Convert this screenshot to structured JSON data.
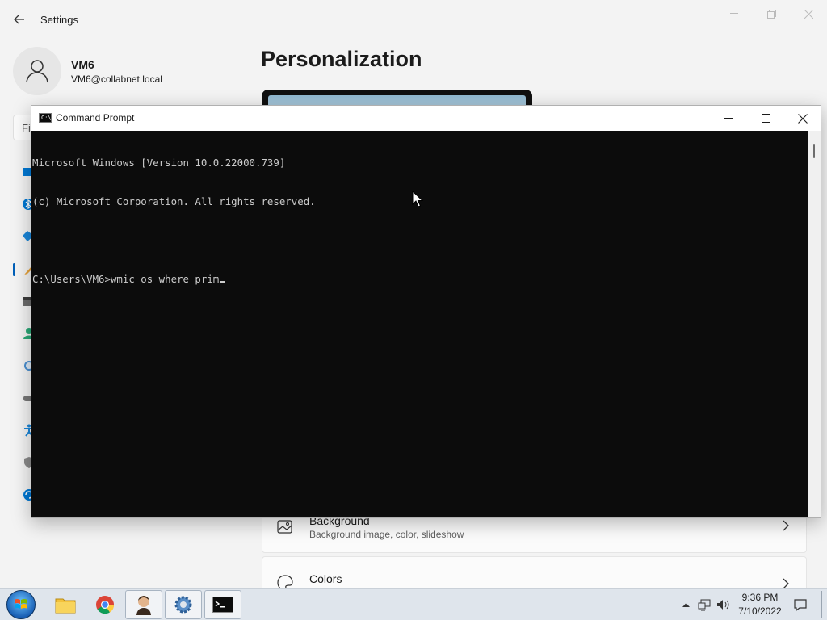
{
  "settings": {
    "app_title": "Settings",
    "user_name": "VM6",
    "user_email": "VM6@collabnet.local",
    "page_title": "Personalization",
    "search_placeholder": "Fi",
    "cards": [
      {
        "title": "Background",
        "subtitle": "Background image, color, slideshow",
        "icon": "image-icon"
      },
      {
        "title": "Colors",
        "subtitle": "",
        "icon": "palette-icon"
      }
    ],
    "nav_icons": [
      "system-icon",
      "bluetooth-icon",
      "network-icon",
      "personalization-icon",
      "apps-icon",
      "accounts-icon",
      "time-language-icon",
      "gaming-icon",
      "accessibility-icon",
      "privacy-icon",
      "update-icon"
    ]
  },
  "cmd": {
    "title": "Command Prompt",
    "lines": [
      "Microsoft Windows [Version 10.0.22000.739]",
      "(c) Microsoft Corporation. All rights reserved.",
      "",
      "C:\\Users\\VM6>wmic os where prim"
    ]
  },
  "taskbar": {
    "apps": [
      "file-explorer-icon",
      "chrome-icon",
      "user-app-icon",
      "settings-icon",
      "command-prompt-icon"
    ],
    "time": "9:36 PM",
    "date": "7/10/2022"
  },
  "colors": {
    "accent": "#005fb8",
    "console_bg": "#0c0c0c",
    "console_fg": "#cccccc"
  }
}
